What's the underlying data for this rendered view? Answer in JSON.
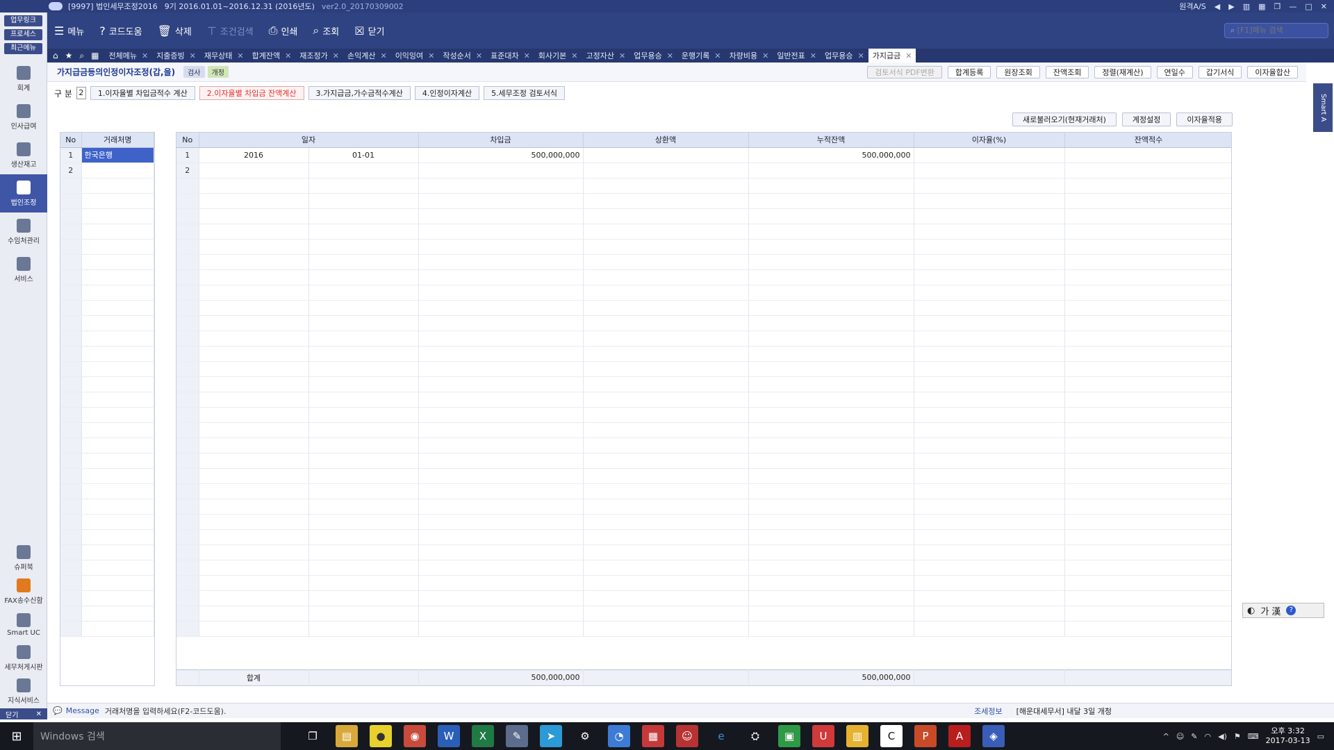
{
  "titlebar": {
    "company": "[9997] 법인세무조정2016",
    "period": "9기  2016.01.01~2016.12.31  (2016년도)",
    "version": "ver2.0_20170309002",
    "remote": "원격A/S"
  },
  "toolbar": {
    "menu": "메뉴",
    "code_help": "코드도움",
    "delete": "삭제",
    "filter": "조건검색",
    "print": "인쇄",
    "query": "조회",
    "close": "닫기",
    "search_placeholder": "[F1]메뉴 검색"
  },
  "tabs": [
    {
      "label": "전체메뉴"
    },
    {
      "label": "지출증빙"
    },
    {
      "label": "재무상태"
    },
    {
      "label": "합계잔액"
    },
    {
      "label": "재조정가"
    },
    {
      "label": "손익계산"
    },
    {
      "label": "이익잉여"
    },
    {
      "label": "작성순서"
    },
    {
      "label": "표준대차"
    },
    {
      "label": "회사기본"
    },
    {
      "label": "고정자산"
    },
    {
      "label": "업무용승"
    },
    {
      "label": "운행기록"
    },
    {
      "label": "차량비용"
    },
    {
      "label": "일반전표"
    },
    {
      "label": "업무용승"
    },
    {
      "label": "가지급금"
    }
  ],
  "sidebar": {
    "top": [
      "업무링크",
      "프로세스",
      "최근메뉴"
    ],
    "items": [
      {
        "label": "회계"
      },
      {
        "label": "인사급여"
      },
      {
        "label": "생산재고"
      },
      {
        "label": "법인조정"
      },
      {
        "label": "수임처관리"
      },
      {
        "label": "서비스"
      }
    ],
    "bottom": [
      {
        "label": "슈퍼북"
      },
      {
        "label": "FAX송수신함"
      },
      {
        "label": "Smart UC"
      },
      {
        "label": "세무처게시판"
      },
      {
        "label": "지식서비스"
      }
    ],
    "close": "닫기"
  },
  "page": {
    "title": "가지급금등의인정이자조정(갑,을)",
    "badge1": "검사",
    "badge2": "개정",
    "header_buttons": [
      "검토서식 PDF변환",
      "합계등록",
      "원장조회",
      "잔액조회",
      "정렬(재계산)",
      "연일수",
      "갑기서식",
      "이자율합산"
    ],
    "section_label": "구 분",
    "section_value": "2",
    "subtabs": [
      "1.이자율별 차입금적수 계산",
      "2.이자율별 차입금 잔액계산",
      "3.가지급금,가수금적수계산",
      "4.인정이자계산",
      "5.세무조정 검토서식"
    ],
    "action_buttons": [
      "새로불러오기(현재거래처)",
      "계정설정",
      "이자율적용"
    ]
  },
  "left_grid": {
    "headers": [
      "No",
      "거래처명"
    ],
    "rows": [
      {
        "no": "1",
        "name": "한국은행"
      },
      {
        "no": "2",
        "name": ""
      }
    ]
  },
  "main_grid": {
    "headers": [
      "No",
      "일자",
      "차입금",
      "상환액",
      "누적잔액",
      "이자율(%)",
      "잔액적수"
    ],
    "rows": [
      {
        "no": "1",
        "year": "2016",
        "md": "01-01",
        "borrow": "500,000,000",
        "repay": "",
        "balance": "500,000,000",
        "rate": "",
        "product": ""
      },
      {
        "no": "2",
        "year": "",
        "md": "",
        "borrow": "",
        "repay": "",
        "balance": "",
        "rate": "",
        "product": ""
      }
    ],
    "total": {
      "label": "합계",
      "borrow": "500,000,000",
      "balance": "500,000,000"
    }
  },
  "side": {
    "smart": "Smart A",
    "ime": "가 漢"
  },
  "status": {
    "message_label": "Message",
    "message": "거래처명을 입력하세요(F2-코드도움).",
    "info_label": "조세정보",
    "info": "[해운대세무서] 내달 3일 개청"
  },
  "taskbar": {
    "search": "Windows 검색",
    "time": "오후 3:32",
    "date": "2017-03-13"
  }
}
